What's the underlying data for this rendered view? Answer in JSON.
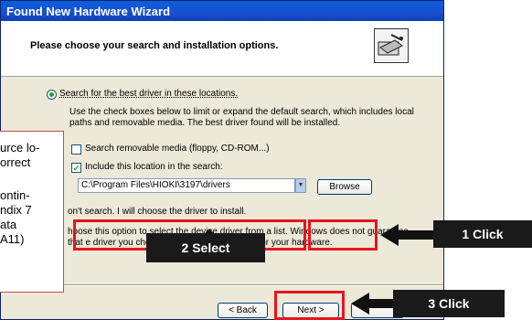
{
  "window": {
    "title": "Found New Hardware Wizard",
    "header_title": "Please choose your search and installation options."
  },
  "options": {
    "search_best_label": "Search for the best driver in these locations.",
    "search_best_desc": "Use the check boxes below to limit or expand the default search, which includes local paths and removable media. The best driver found will be installed.",
    "removable_media_label": "Search removable media (floppy, CD-ROM...)",
    "include_location_label": "Include this location in the search:",
    "location_value": "C:\\Program Files\\HIOKI\\3197\\drivers",
    "browse_label": "Browse",
    "dont_search_label": "on't search. I will choose the driver to install.",
    "dont_search_desc": "hoose this option to select the device driver from a list. Windows does not guarantee that e driver you choose will be the best match for your hardware."
  },
  "buttons": {
    "back_label": "< Back",
    "next_label": "Next >"
  },
  "annotations": {
    "click1": "1  Click",
    "select2": "2  Select",
    "click3": "3  Click",
    "callout_lines": [
      "urce lo-",
      "orrect",
      "",
      "ontin-",
      "ndix 7",
      "ata",
      "A11)"
    ]
  },
  "colors": {
    "highlight": "#E8141E",
    "label_bg": "#1A1A1A",
    "titlebar": "#0A5EDB"
  }
}
